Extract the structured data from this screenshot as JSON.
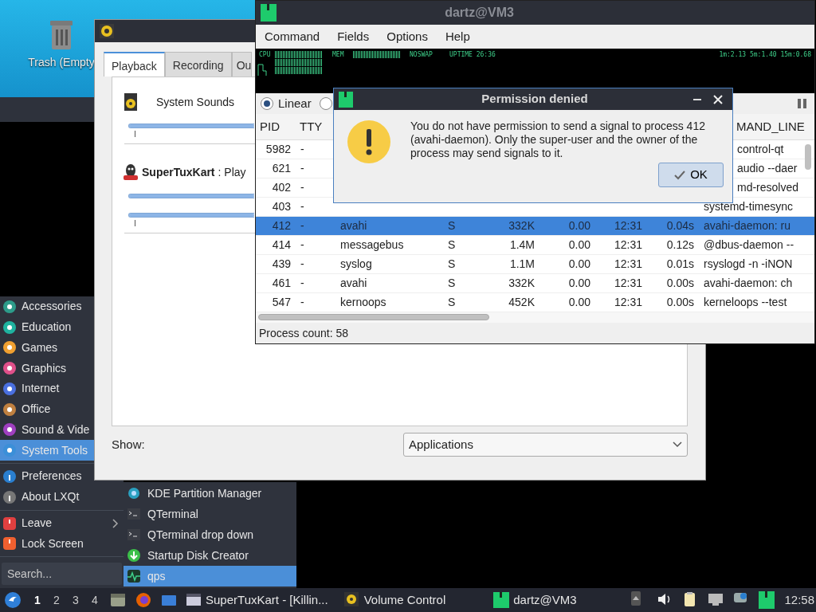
{
  "desktop": {
    "icons": [
      {
        "label": "Trash (Empty"
      }
    ]
  },
  "start_menu": {
    "categories": [
      {
        "label": "Accessories",
        "selected": false
      },
      {
        "label": "Education",
        "selected": false
      },
      {
        "label": "Games",
        "selected": false
      },
      {
        "label": "Graphics",
        "selected": false
      },
      {
        "label": "Internet",
        "selected": false
      },
      {
        "label": "Office",
        "selected": false
      },
      {
        "label": "Sound & Vide",
        "selected": false
      },
      {
        "label": "System Tools",
        "selected": true
      }
    ],
    "extras": [
      {
        "label": "Preferences"
      },
      {
        "label": "About LXQt"
      }
    ],
    "session": [
      {
        "label": "Leave",
        "submenu": true
      },
      {
        "label": "Lock Screen",
        "submenu": false
      }
    ],
    "search": {
      "placeholder": "Search..."
    },
    "submenu": [
      {
        "label": "KDE Partition Manager",
        "selected": false
      },
      {
        "label": "QTerminal",
        "selected": false
      },
      {
        "label": "QTerminal drop down",
        "selected": false
      },
      {
        "label": "Startup Disk Creator",
        "selected": false
      },
      {
        "label": "qps",
        "selected": true
      }
    ]
  },
  "volume_window": {
    "tabs": [
      {
        "label": "Playback",
        "selected": true
      },
      {
        "label": "Recording",
        "selected": false
      },
      {
        "label": "Ou",
        "selected": false
      }
    ],
    "streams": [
      {
        "kind": "device",
        "name": "System Sounds",
        "sliders": [
          {
            "level": 1
          }
        ]
      },
      {
        "kind": "app",
        "name": "SuperTuxKart",
        "detail": ": Play",
        "sliders": [
          {
            "level": 1
          },
          {
            "level": 1
          }
        ]
      }
    ],
    "show_label": "Show:",
    "show_value": "Applications"
  },
  "qps_window": {
    "title": "dartz@VM3",
    "menu": [
      "Command",
      "Fields",
      "Options",
      "Help"
    ],
    "graph": {
      "cpu": "CPU",
      "mem": "MEM",
      "swap": "NOSWAP",
      "uptime": "UPTIME 26:36",
      "load": "1m:2.13 5m:1.40 15m:0.68"
    },
    "view_modes": [
      {
        "label": "Linear",
        "selected": true
      },
      {
        "selected": false
      }
    ],
    "columns": [
      "PID",
      "TTY",
      "MAND_LINE"
    ],
    "rows": [
      {
        "kind": "covered",
        "pid": "5982",
        "tty": "-",
        "cmd": "control-qt",
        "selected": false
      },
      {
        "kind": "covered",
        "pid": "621",
        "tty": "-",
        "cmd": "audio --daer",
        "selected": false
      },
      {
        "kind": "covered",
        "pid": "402",
        "tty": "-",
        "cmd": "md-resolved",
        "selected": false
      },
      {
        "kind": "full",
        "pid": "403",
        "tty": "-",
        "cmd": "systemd-timesync",
        "selected": false
      },
      {
        "kind": "full",
        "pid": "412",
        "tty": "-",
        "user": "avahi",
        "stat": "S",
        "rss": "332K",
        "cpu": "0.00",
        "start": "12:31",
        "time": "0.04s",
        "cmd": "avahi-daemon: ru",
        "selected": true
      },
      {
        "kind": "full",
        "pid": "414",
        "tty": "-",
        "user": "messagebus",
        "stat": "S",
        "rss": "1.4M",
        "cpu": "0.00",
        "start": "12:31",
        "time": "0.12s",
        "cmd": "@dbus-daemon --",
        "selected": false
      },
      {
        "kind": "full",
        "pid": "439",
        "tty": "-",
        "user": "syslog",
        "stat": "S",
        "rss": "1.1M",
        "cpu": "0.00",
        "start": "12:31",
        "time": "0.01s",
        "cmd": "rsyslogd -n -iNON",
        "selected": false
      },
      {
        "kind": "full",
        "pid": "461",
        "tty": "-",
        "user": "avahi",
        "stat": "S",
        "rss": "332K",
        "cpu": "0.00",
        "start": "12:31",
        "time": "0.00s",
        "cmd": "avahi-daemon: ch",
        "selected": false
      },
      {
        "kind": "full",
        "pid": "547",
        "tty": "-",
        "user": "kernoops",
        "stat": "S",
        "rss": "452K",
        "cpu": "0.00",
        "start": "12:31",
        "time": "0.00s",
        "cmd": "kerneloops --test",
        "selected": false
      }
    ],
    "status": "Process count: 58"
  },
  "dialog": {
    "title": "Permission denied",
    "message": "You do not have permission to send a signal to process 412 (avahi-daemon). Only the super-user and the owner of the process may send signals to it.",
    "button": "OK"
  },
  "taskbar": {
    "desktops": [
      {
        "label": "1",
        "selected": true
      },
      {
        "label": "2",
        "selected": false
      },
      {
        "label": "3",
        "selected": false
      },
      {
        "label": "4",
        "selected": false
      }
    ],
    "tasks": [
      {
        "kind": "window",
        "label": "SuperTuxKart - [Killin..."
      },
      {
        "kind": "speaker",
        "label": "Volume Control"
      },
      {
        "kind": "monitor",
        "label": "dartz@VM3"
      }
    ],
    "clock": "12:58"
  }
}
